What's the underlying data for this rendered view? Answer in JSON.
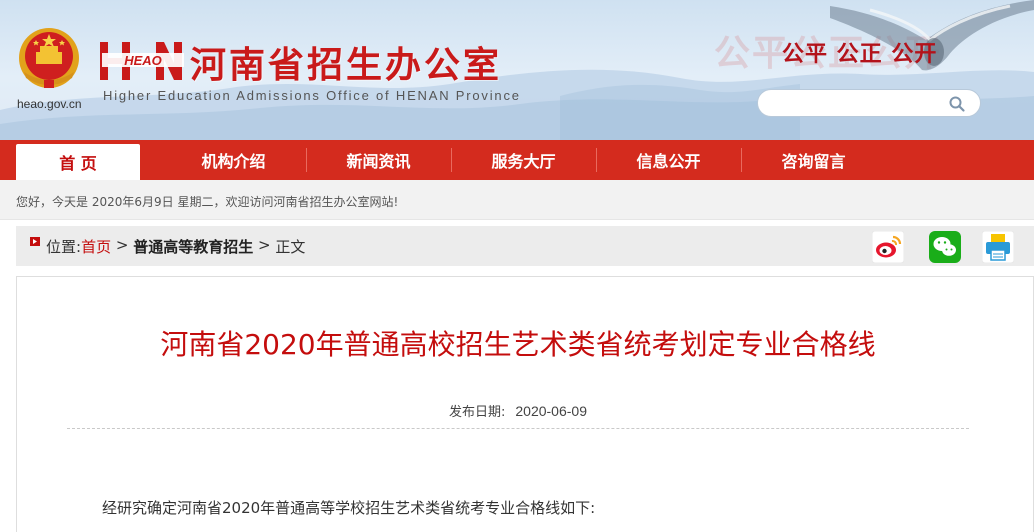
{
  "header": {
    "domain": "heao.gov.cn",
    "logo_text": "HEAO",
    "title": "河南省招生办公室",
    "subtitle": "Higher Education Admissions Office of HENAN Province",
    "slogan_ghost": "公平公正公开",
    "slogan": "公平 公正 公开",
    "search": {
      "placeholder": "",
      "value": ""
    },
    "colors": {
      "brand_red": "#c91a1a",
      "sky": "#cfe1f1"
    }
  },
  "nav": {
    "items": [
      {
        "label": "首 页",
        "active": true
      },
      {
        "label": "机构介绍",
        "active": false
      },
      {
        "label": "新闻资讯",
        "active": false
      },
      {
        "label": "服务大厅",
        "active": false
      },
      {
        "label": "信息公开",
        "active": false
      },
      {
        "label": "咨询留言",
        "active": false
      }
    ],
    "color": "#d42b1e"
  },
  "welcome": {
    "text": "您好，今天是 2020年6月9日 星期二，欢迎访问河南省招生办公室网站!"
  },
  "breadcrumb": {
    "prefix": "位置:",
    "home": "首页",
    "sep": " > ",
    "category": "普通高等教育招生",
    "current": "正文",
    "share_icons": [
      "weibo-icon",
      "wechat-icon",
      "print-icon"
    ]
  },
  "article": {
    "title": "河南省2020年普通高校招生艺术类省统考划定专业合格线",
    "date_label": "发布日期:",
    "date": "2020-06-09",
    "paragraph": "经研究确定河南省2020年普通高等学校招生艺术类省统考专业合格线如下:"
  }
}
